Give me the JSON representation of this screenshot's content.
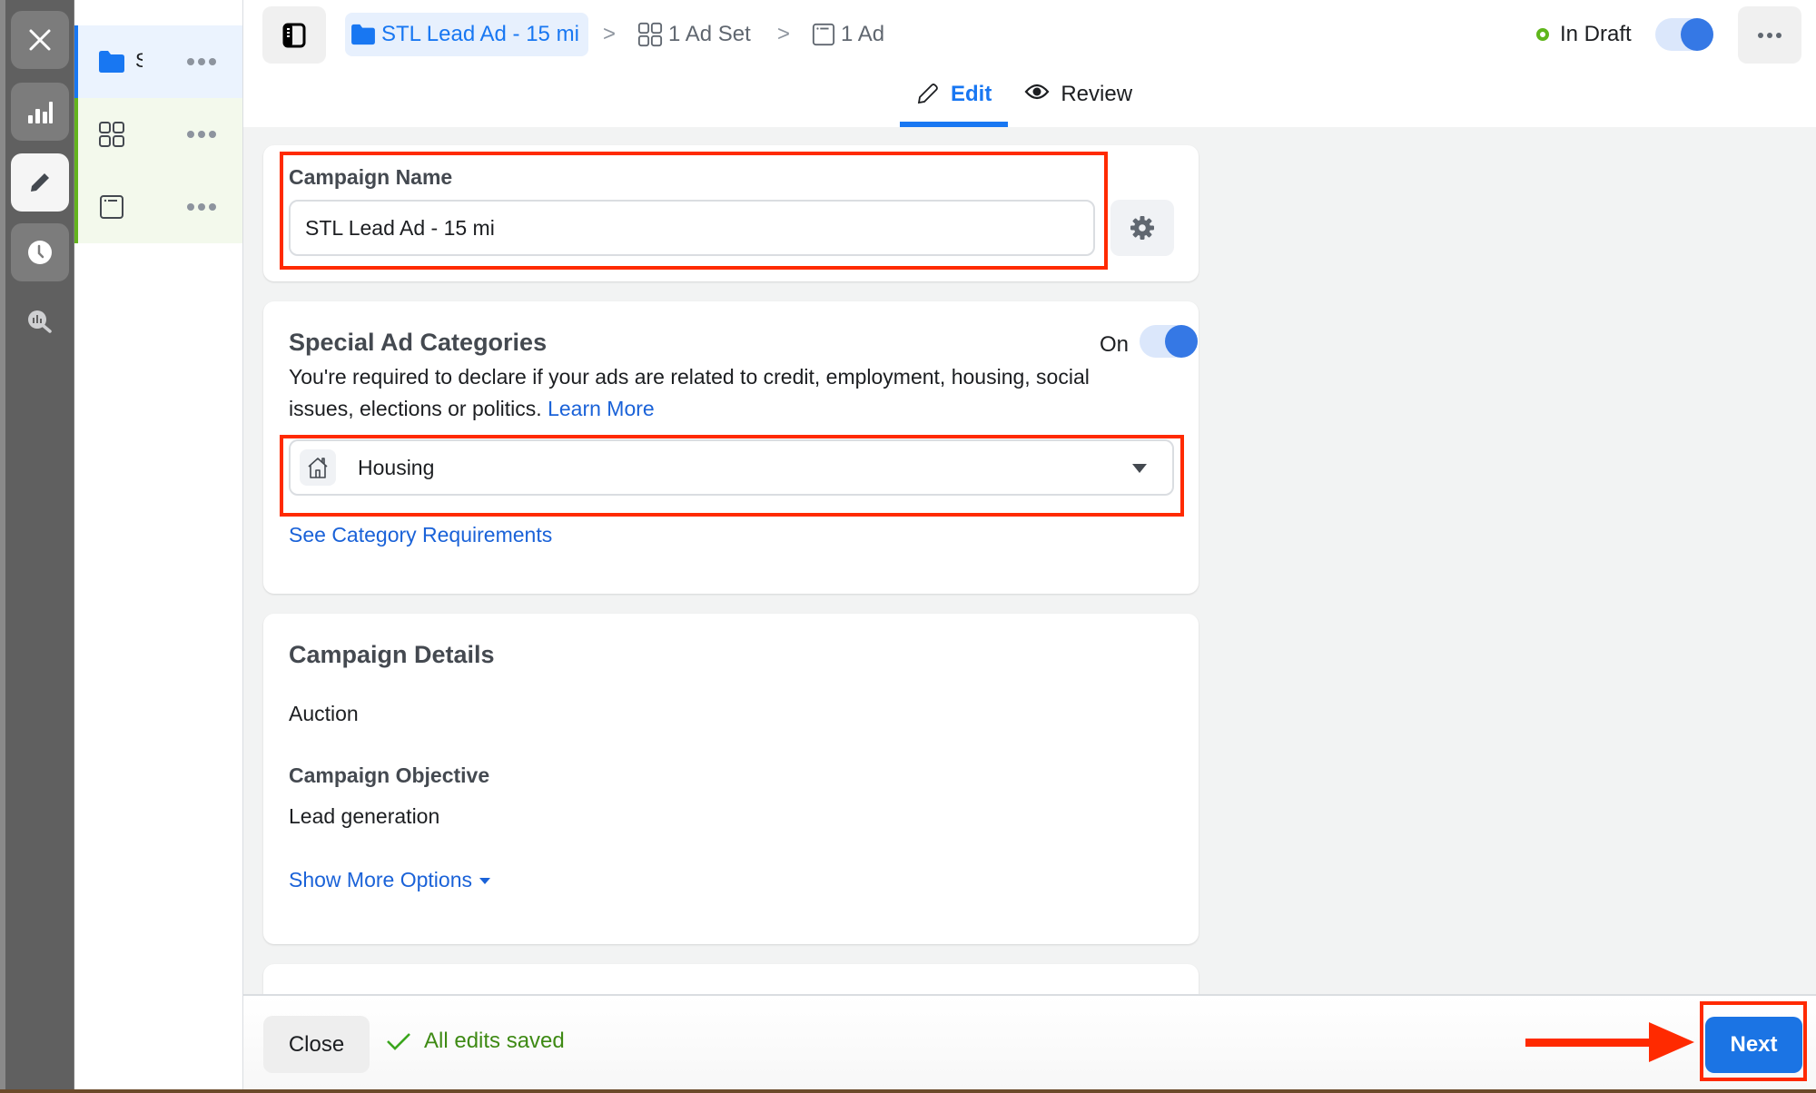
{
  "rail": {
    "items": [
      {
        "name": "close",
        "icon": "close-icon"
      },
      {
        "name": "reporting",
        "icon": "bar-chart-icon"
      },
      {
        "name": "edit",
        "icon": "pencil-icon",
        "active": true
      },
      {
        "name": "history",
        "icon": "clock-icon"
      },
      {
        "name": "analyze",
        "icon": "chart-search-icon"
      }
    ]
  },
  "tree": {
    "items": [
      {
        "type": "campaign",
        "label": "S",
        "icon": "folder-icon"
      },
      {
        "type": "ad-set",
        "label": "",
        "icon": "grid-icon"
      },
      {
        "type": "ad",
        "label": "",
        "icon": "ad-window-icon"
      }
    ]
  },
  "header": {
    "breadcrumb": {
      "campaign": "STL Lead Ad - 15 mi",
      "ad_set": "1 Ad Set",
      "ad": "1 Ad",
      "separator": ">"
    },
    "status": "In Draft",
    "status_color": "#5fb61b",
    "publish_toggle_on": true,
    "tabs": [
      {
        "label": "Edit",
        "icon": "pencil-outline-icon",
        "active": true
      },
      {
        "label": "Review",
        "icon": "eye-icon",
        "active": false
      }
    ]
  },
  "campaign_name": {
    "label": "Campaign Name",
    "value": "STL Lead Ad - 15 mi"
  },
  "special_ad_categories": {
    "title": "Special Ad Categories",
    "toggle_label": "On",
    "toggle_on": true,
    "description": "You're required to declare if your ads are related to credit, employment, housing, social issues, elections or politics.",
    "learn_more": "Learn More",
    "selected_category": "Housing",
    "requirements_link": "See Category Requirements"
  },
  "campaign_details": {
    "title": "Campaign Details",
    "buying_type": "Auction",
    "objective_label": "Campaign Objective",
    "objective_value": "Lead generation",
    "show_more": "Show More Options"
  },
  "footer": {
    "close_label": "Close",
    "saved_status": "All edits saved",
    "next_label": "Next"
  },
  "colors": {
    "accent": "#1877f2",
    "next_button": "#1b74e4",
    "saved_green": "#3e8a14",
    "annotation_red": "#ff2a00"
  }
}
